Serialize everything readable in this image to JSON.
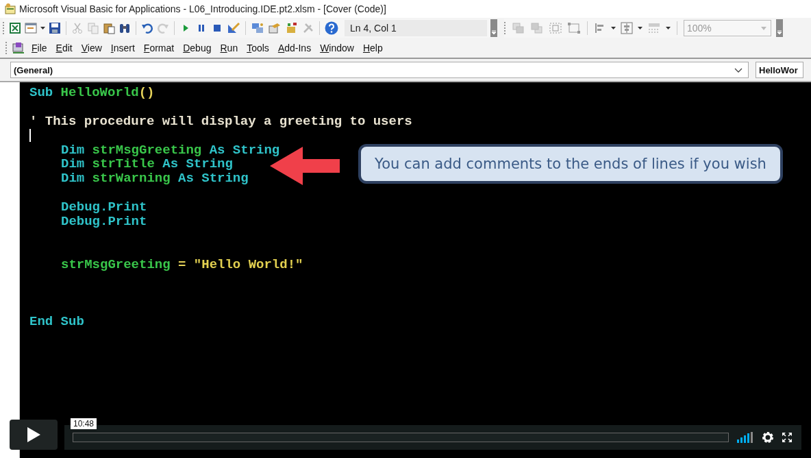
{
  "window": {
    "title": "Microsoft Visual Basic for Applications - L06_Introducing.IDE.pt2.xlsm - [Cover (Code)]"
  },
  "toolbar": {
    "position": "Ln 4, Col 1",
    "zoom": "100%"
  },
  "menu": [
    {
      "label": "File"
    },
    {
      "label": "Edit"
    },
    {
      "label": "View"
    },
    {
      "label": "Insert"
    },
    {
      "label": "Format"
    },
    {
      "label": "Debug"
    },
    {
      "label": "Run"
    },
    {
      "label": "Tools"
    },
    {
      "label": "Add-Ins"
    },
    {
      "label": "Window"
    },
    {
      "label": "Help"
    }
  ],
  "object_box": {
    "value": "(General)"
  },
  "procedure_box": {
    "value": "HelloWor"
  },
  "code": [
    {
      "kind": "code",
      "indented": false,
      "caret": false,
      "tokens": [
        {
          "kind": "keyword",
          "text": "Sub "
        },
        {
          "kind": "name",
          "text": "HelloWorld"
        },
        {
          "kind": "punct",
          "text": "()"
        }
      ]
    },
    {
      "kind": "blank",
      "caret": false
    },
    {
      "kind": "code",
      "indented": false,
      "caret": false,
      "tokens": [
        {
          "kind": "comment",
          "text": "' This procedure will display a greeting to users"
        }
      ]
    },
    {
      "kind": "blank",
      "caret": true
    },
    {
      "kind": "code",
      "indented": true,
      "caret": false,
      "tokens": [
        {
          "kind": "keyword",
          "text": "Dim "
        },
        {
          "kind": "name",
          "text": "strMsgGreeting "
        },
        {
          "kind": "keyword",
          "text": "As String"
        }
      ]
    },
    {
      "kind": "code",
      "indented": true,
      "caret": false,
      "tokens": [
        {
          "kind": "keyword",
          "text": "Dim "
        },
        {
          "kind": "name",
          "text": "strTitle "
        },
        {
          "kind": "keyword",
          "text": "As String"
        }
      ]
    },
    {
      "kind": "code",
      "indented": true,
      "caret": false,
      "tokens": [
        {
          "kind": "keyword",
          "text": "Dim "
        },
        {
          "kind": "name",
          "text": "strWarning "
        },
        {
          "kind": "keyword",
          "text": "As String"
        }
      ]
    },
    {
      "kind": "blank",
      "caret": false
    },
    {
      "kind": "code",
      "indented": true,
      "caret": false,
      "tokens": [
        {
          "kind": "keyword",
          "text": "Debug.Print"
        }
      ]
    },
    {
      "kind": "code",
      "indented": true,
      "caret": false,
      "tokens": [
        {
          "kind": "keyword",
          "text": "Debug.Print"
        }
      ]
    },
    {
      "kind": "blank",
      "caret": false
    },
    {
      "kind": "blank",
      "caret": false
    },
    {
      "kind": "code",
      "indented": true,
      "caret": false,
      "tokens": [
        {
          "kind": "name",
          "text": "strMsgGreeting "
        },
        {
          "kind": "punct",
          "text": "= "
        },
        {
          "kind": "string",
          "text": "\"Hello World!\""
        }
      ]
    },
    {
      "kind": "blank",
      "caret": false
    },
    {
      "kind": "blank",
      "caret": false
    },
    {
      "kind": "blank",
      "caret": false
    },
    {
      "kind": "code",
      "indented": false,
      "caret": false,
      "tokens": [
        {
          "kind": "keyword",
          "text": "End Sub"
        }
      ]
    }
  ],
  "callout": {
    "text": "You can add comments to the ends of lines if you wish"
  },
  "player": {
    "time": "10:48",
    "level": 0
  }
}
